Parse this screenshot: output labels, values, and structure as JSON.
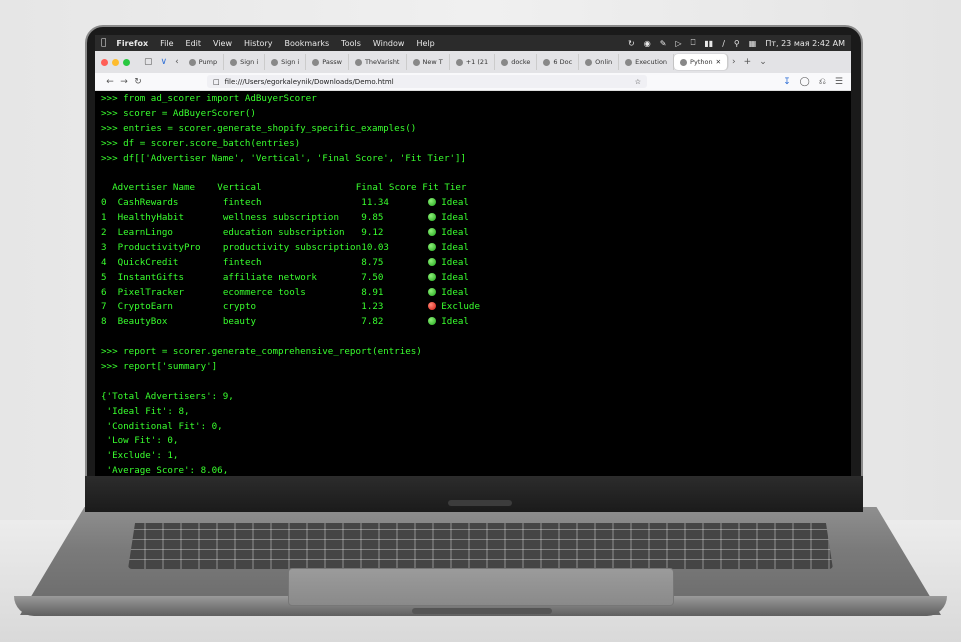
{
  "menubar": {
    "app": "Firefox",
    "items": [
      "File",
      "Edit",
      "View",
      "History",
      "Bookmarks",
      "Tools",
      "Window",
      "Help"
    ],
    "datetime": "Пт, 23 мая  2:42 AM"
  },
  "tabs": [
    {
      "label": "Pump",
      "icon": "globe-icon"
    },
    {
      "label": "Sign i",
      "icon": "google-icon"
    },
    {
      "label": "Sign i",
      "icon": "github-icon"
    },
    {
      "label": "Passw",
      "icon": "firefox-icon"
    },
    {
      "label": "TheVarisht",
      "icon": "page-icon"
    },
    {
      "label": "New T",
      "icon": "firefox-icon"
    },
    {
      "label": "+1 (21",
      "icon": "google-icon"
    },
    {
      "label": "docke",
      "icon": "google-icon"
    },
    {
      "label": "6 Doc",
      "icon": "doc-icon"
    },
    {
      "label": "Onlin",
      "icon": "pen-icon"
    },
    {
      "label": "Execution",
      "icon": "page-icon"
    },
    {
      "label": "Python",
      "icon": "page-icon",
      "active": true
    }
  ],
  "navbar": {
    "url": "file:///Users/egorkaleynik/Downloads/Demo.html"
  },
  "terminal": {
    "prompt": ">>>",
    "commands": [
      "from ad_scorer import AdBuyerScorer",
      "scorer = AdBuyerScorer()",
      "entries = scorer.generate_shopify_specific_examples()",
      "df = scorer.score_batch(entries)",
      "df[['Advertiser Name', 'Vertical', 'Final Score', 'Fit Tier']]"
    ],
    "table": {
      "headers": [
        "Advertiser Name",
        "Vertical",
        "Final Score",
        "Fit Tier"
      ],
      "rows": [
        {
          "idx": "0",
          "name": "CashRewards",
          "vertical": "fintech",
          "score": "11.34",
          "tier": "Ideal",
          "status": "green"
        },
        {
          "idx": "1",
          "name": "HealthyHabit",
          "vertical": "wellness subscription",
          "score": "9.85",
          "tier": "Ideal",
          "status": "green"
        },
        {
          "idx": "2",
          "name": "LearnLingo",
          "vertical": "education subscription",
          "score": "9.12",
          "tier": "Ideal",
          "status": "green"
        },
        {
          "idx": "3",
          "name": "ProductivityPro",
          "vertical": "productivity subscription",
          "score": "10.03",
          "tier": "Ideal",
          "status": "green"
        },
        {
          "idx": "4",
          "name": "QuickCredit",
          "vertical": "fintech",
          "score": "8.75",
          "tier": "Ideal",
          "status": "green"
        },
        {
          "idx": "5",
          "name": "InstantGifts",
          "vertical": "affiliate network",
          "score": "7.50",
          "tier": "Ideal",
          "status": "green"
        },
        {
          "idx": "6",
          "name": "PixelTracker",
          "vertical": "ecommerce tools",
          "score": "8.91",
          "tier": "Ideal",
          "status": "green"
        },
        {
          "idx": "7",
          "name": "CryptoEarn",
          "vertical": "crypto",
          "score": "1.23",
          "tier": "Exclude",
          "status": "red"
        },
        {
          "idx": "8",
          "name": "BeautyBox",
          "vertical": "beauty",
          "score": "7.82",
          "tier": "Ideal",
          "status": "green"
        }
      ]
    },
    "commands2": [
      "report = scorer.generate_comprehensive_report(entries)",
      "report['summary']"
    ],
    "summary": [
      "{'Total Advertisers': 9,",
      " 'Ideal Fit': 8,",
      " 'Conditional Fit': 0,",
      " 'Low Fit': 0,",
      " 'Exclude': 1,",
      " 'Average Score': 8.06,"
    ]
  },
  "colors": {
    "terminal_text": "#39ff2e",
    "status_green": "#1fa81a",
    "status_red": "#d11a10"
  }
}
